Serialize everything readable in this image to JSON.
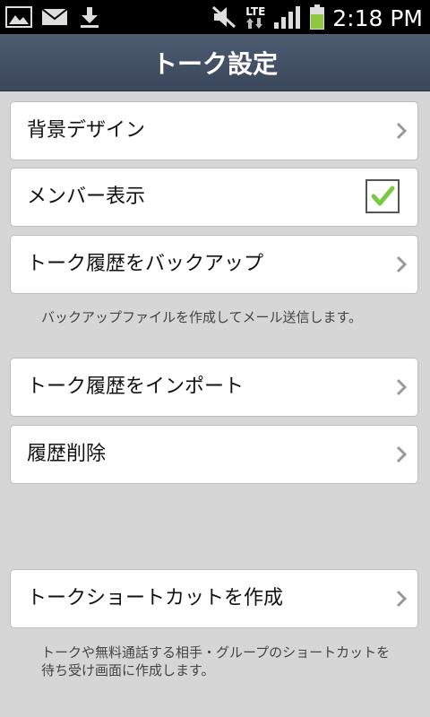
{
  "status_bar": {
    "time": "2:18 PM",
    "network": "LTE",
    "icons": [
      "gallery-icon",
      "mail-icon",
      "download-icon",
      "mute-icon",
      "lte-icon",
      "signal-icon",
      "battery-icon"
    ]
  },
  "header": {
    "title": "トーク設定"
  },
  "settings": {
    "background_design": "背景デザイン",
    "member_display": "メンバー表示",
    "member_display_checked": true,
    "backup_history": "トーク履歴をバックアップ",
    "backup_note": "バックアップファイルを作成してメール送信します。",
    "import_history": "トーク履歴をインポート",
    "delete_history": "履歴削除",
    "create_shortcut": "トークショートカットを作成",
    "shortcut_note": "トークや無料通話する相手・グループのショートカットを待ち受け画面に作成します。"
  },
  "colors": {
    "header_bg": "#45536a",
    "check_green": "#7ac943"
  }
}
